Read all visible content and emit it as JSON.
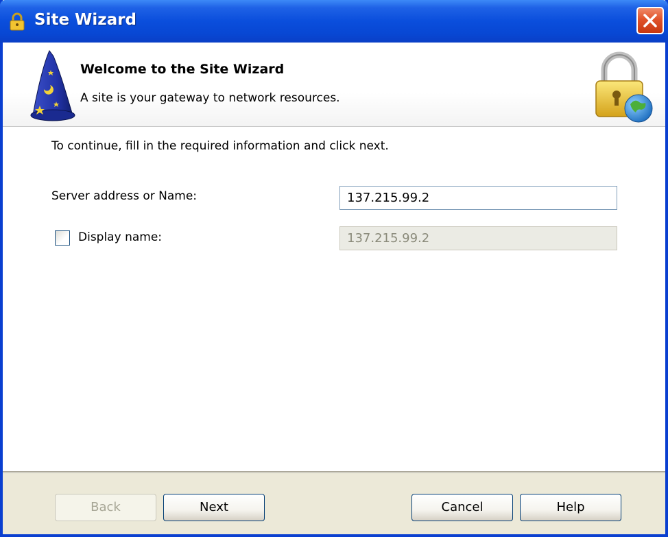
{
  "window": {
    "title": "Site Wizard"
  },
  "header": {
    "title": "Welcome to the Site Wizard",
    "subtitle": "A site is your gateway to network resources."
  },
  "form": {
    "instructions": "To continue, fill in the required information and click next.",
    "server_label": "Server address or Name:",
    "server_value": "137.215.99.2",
    "display_label": "Display name:",
    "display_checked": false,
    "display_value": "137.215.99.2"
  },
  "buttons": {
    "back": "Back",
    "next": "Next",
    "cancel": "Cancel",
    "help": "Help"
  },
  "icons": {
    "title_icon": "lock-icon",
    "header_left": "wizard-hat-icon",
    "header_right": "lock-globe-icon",
    "close": "close-icon"
  },
  "colors": {
    "titlebar": "#0a4edc",
    "close_button": "#e0522a",
    "window_frame": "#0a3fd0",
    "dialog_bg": "#ece9d8"
  }
}
